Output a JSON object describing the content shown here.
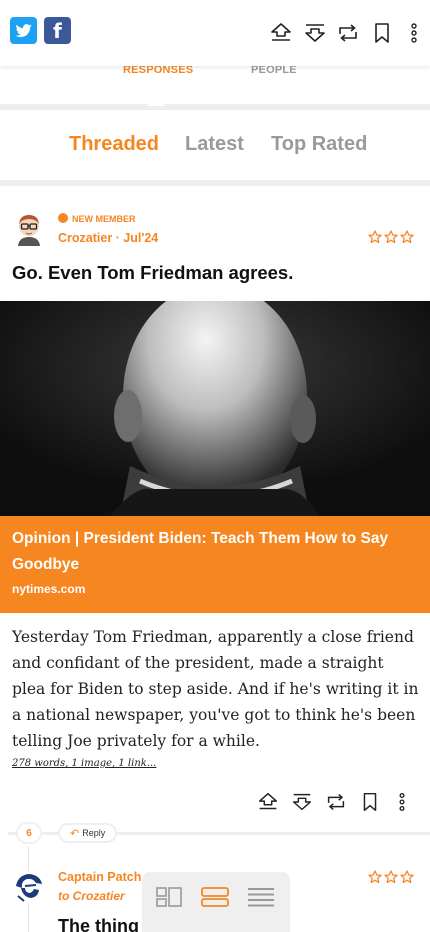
{
  "topbar": {
    "twitter_icon": "twitter-icon",
    "facebook_icon": "facebook-icon",
    "tools": [
      "upvote-icon",
      "downvote-icon",
      "repost-icon",
      "bookmark-icon",
      "more-vertical-icon"
    ]
  },
  "subnav": {
    "responses": "RESPONSES",
    "people": "PEOPLE"
  },
  "sort_tabs": [
    "Threaded",
    "Latest",
    "Top Rated"
  ],
  "post": {
    "member_badge": "NEW MEMBER",
    "author_line": "Crozatier · Jul'24",
    "title": "Go. Even Tom Friedman agrees.",
    "link_title": "Opinion | President Biden: Teach Them How to Say Goodbye",
    "link_source": "nytimes.com",
    "body": "Yesterday Tom Friedman, apparently a close friend and confidant of the president, made a straight plea for Biden to step aside. And if he's writing it in a national newspaper, you've got to think he's been telling Joe privately for a while.",
    "word_count": "278 words, 1 image, 1 link..."
  },
  "reply": {
    "count": "6",
    "reply_label": "Reply",
    "author": "Captain Patch",
    "to": "to Crozatier",
    "title_start": "The thing"
  },
  "colors": {
    "accent": "#f6861f",
    "muted": "#9a9a9a",
    "twitter": "#1da1f2",
    "facebook": "#3b5998"
  }
}
